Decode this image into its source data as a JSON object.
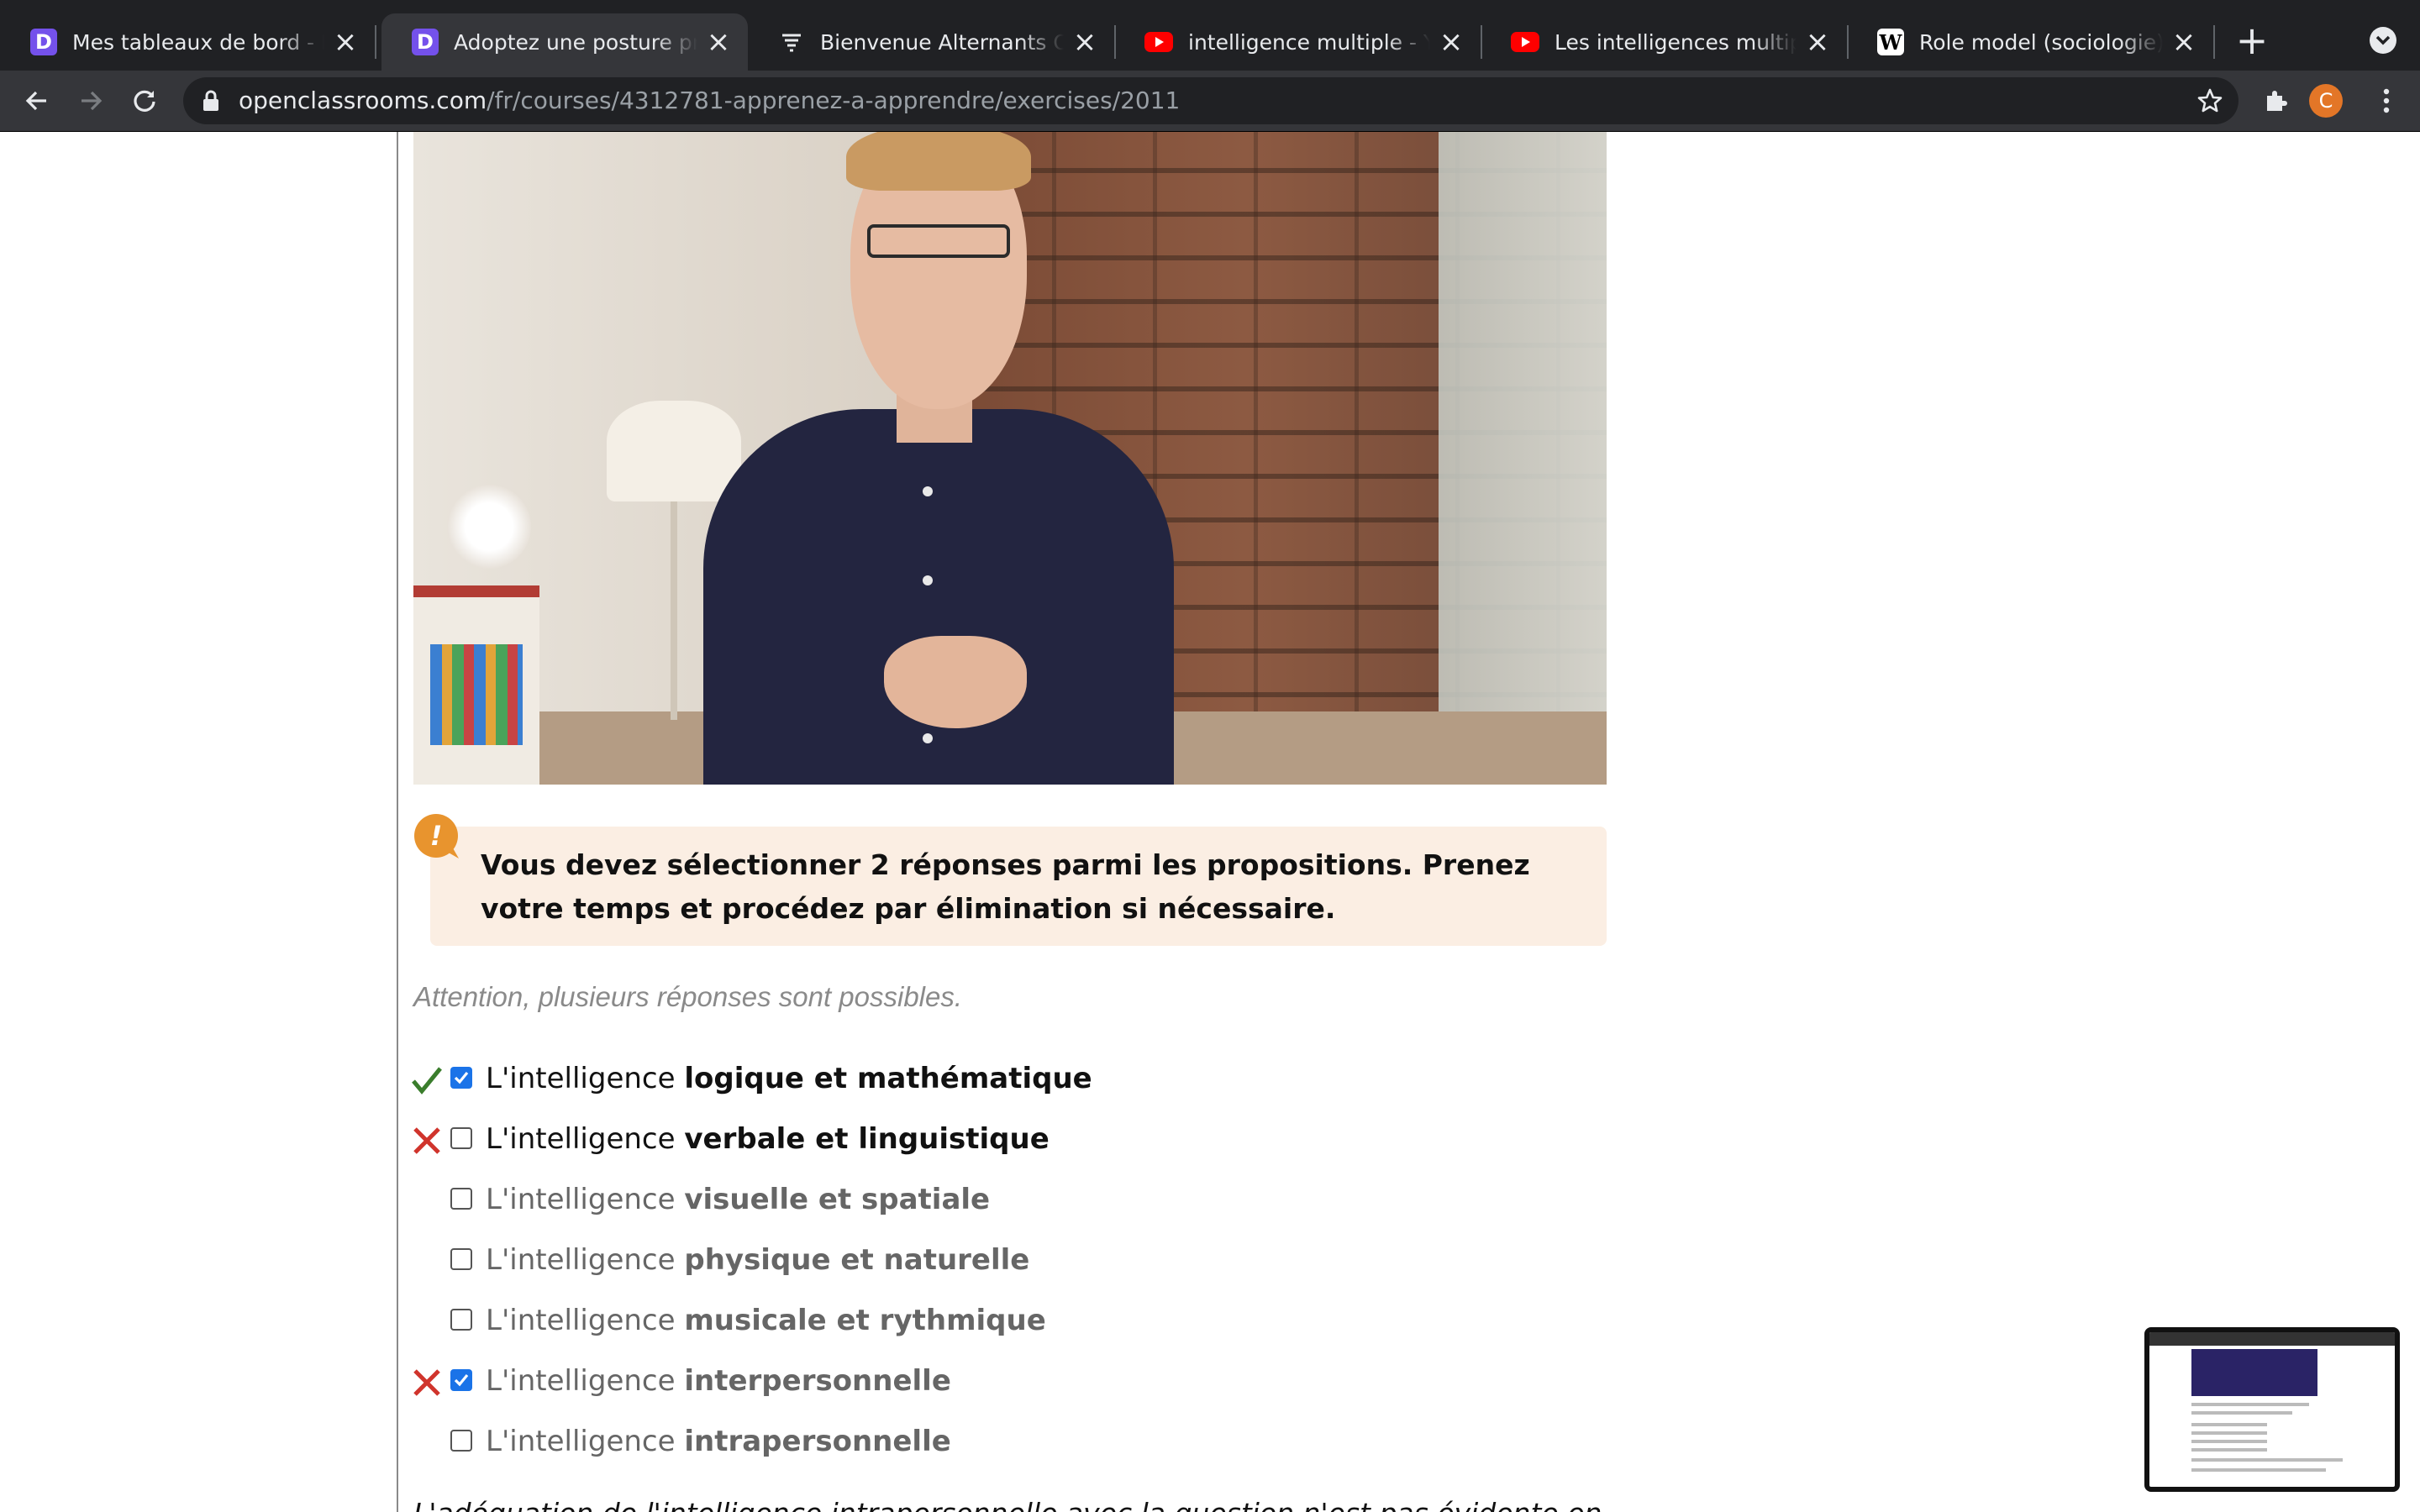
{
  "browser": {
    "tabs": [
      {
        "title": "Mes tableaux de bord - Mon",
        "favicon": "openclassrooms-icon",
        "active": false
      },
      {
        "title": "Adoptez une posture propice",
        "favicon": "openclassrooms-icon",
        "active": true
      },
      {
        "title": "Bienvenue Alternants OpenC",
        "favicon": "wr-icon",
        "active": false
      },
      {
        "title": "intelligence multiple - YouTube",
        "favicon": "youtube-icon",
        "active": false
      },
      {
        "title": "Les intelligences multiples : ",
        "favicon": "youtube-icon",
        "active": false
      },
      {
        "title": "Role model (sociologie) — Wikipédia",
        "favicon": "wikipedia-icon",
        "active": false
      }
    ],
    "url_host": "openclassrooms.com",
    "url_path": "/fr/courses/4312781-apprenez-a-apprendre/exercises/2011",
    "profile_initial": "C",
    "colors": {
      "tabbar": "#202124",
      "toolbar": "#35363a",
      "avatar": "#e37627"
    }
  },
  "exercise": {
    "callout": "Vous devez sélectionner 2 réponses parmi les propositions. Prenez votre temps et procédez par élimination si nécessaire.",
    "hint": "Attention, plusieurs réponses sont possibles.",
    "answer_prefix": "L'intelligence",
    "answers": [
      {
        "label": "logique et mathématique",
        "checked": true,
        "result": "correct"
      },
      {
        "label": "verbale et linguistique",
        "checked": false,
        "result": "incorrect"
      },
      {
        "label": "visuelle et spatiale",
        "checked": false,
        "result": "none"
      },
      {
        "label": "physique et naturelle",
        "checked": false,
        "result": "none"
      },
      {
        "label": "musicale et rythmique",
        "checked": false,
        "result": "none"
      },
      {
        "label": "interpersonnelle",
        "checked": true,
        "result": "incorrect"
      },
      {
        "label": "intrapersonnelle",
        "checked": false,
        "result": "none"
      }
    ],
    "colors": {
      "correct": "#3a7d2c",
      "incorrect": "#d0342c",
      "checkbox_checked": "#1a73e8",
      "callout_bg": "#fbeee3",
      "callout_icon": "#e8942e"
    }
  },
  "trailing_text": "L'adéquation de l'intelligence intrapersonnelle avec la question n'est pas évidente en soi car il s'agit..."
}
